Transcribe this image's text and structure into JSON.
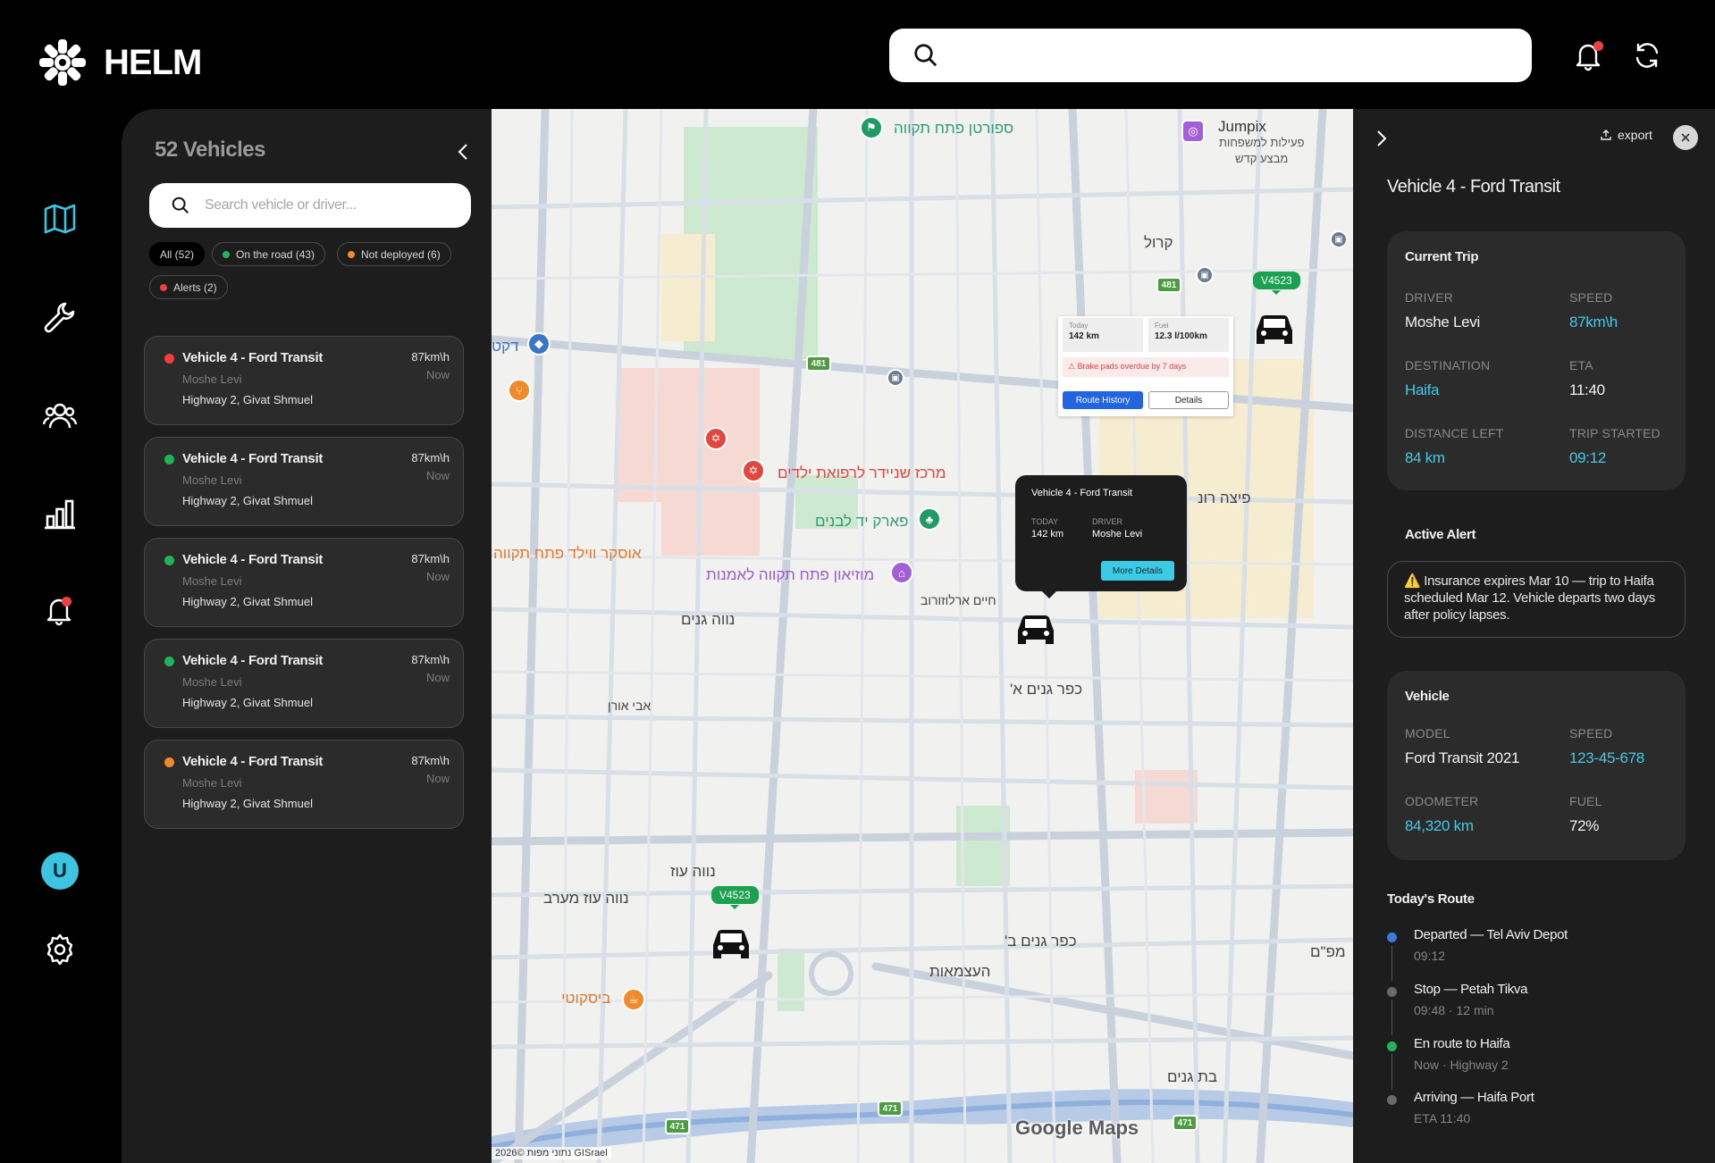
{
  "app": {
    "name": "HELM"
  },
  "topbar": {
    "search_value": ""
  },
  "vehicles_panel": {
    "title": "52 Vehicles",
    "search_placeholder": "Search vehicle or driver...",
    "filters": [
      {
        "label": "All (52)",
        "color": ""
      },
      {
        "label": "On the road (43)",
        "color": "#22b35a"
      },
      {
        "label": "Not deployed (6)",
        "color": "#f08a2b"
      },
      {
        "label": "Alerts (2)",
        "color": "#ef3f3f"
      }
    ],
    "vehicles": [
      {
        "name": "Vehicle 4 - Ford Transit",
        "driver": "Moshe Levi",
        "location": "Highway 2, Givat Shmuel",
        "speed": "87km\\h",
        "time": "Now",
        "status_color": "#ef3f3f"
      },
      {
        "name": "Vehicle 4 - Ford Transit",
        "driver": "Moshe Levi",
        "location": "Highway 2, Givat Shmuel",
        "speed": "87km\\h",
        "time": "Now",
        "status_color": "#22b35a"
      },
      {
        "name": "Vehicle 4 - Ford Transit",
        "driver": "Moshe Levi",
        "location": "Highway 2, Givat Shmuel",
        "speed": "87km\\h",
        "time": "Now",
        "status_color": "#22b35a"
      },
      {
        "name": "Vehicle 4 - Ford Transit",
        "driver": "Moshe Levi",
        "location": "Highway 2, Givat Shmuel",
        "speed": "87km\\h",
        "time": "Now",
        "status_color": "#22b35a"
      },
      {
        "name": "Vehicle 4 - Ford Transit",
        "driver": "Moshe Levi",
        "location": "Highway 2, Givat Shmuel",
        "speed": "87km\\h",
        "time": "Now",
        "status_color": "#f08a2b"
      }
    ]
  },
  "user": {
    "initial": "U"
  },
  "map": {
    "labels": [
      {
        "text": "ספורטן פתח תקווה",
        "color": "#2f9b77"
      },
      {
        "text": "Jumpix",
        "color": "#333333"
      },
      {
        "text": "פעילות למשפחות",
        "color": "#555555"
      },
      {
        "text": "מבצע קדש",
        "color": "#555555"
      },
      {
        "text": "קרול",
        "color": "#444444"
      },
      {
        "text": "מרכז שניידר לרפואת ילדים",
        "color": "#e0483f"
      },
      {
        "text": "פארק יד לבנים",
        "color": "#2f9b77"
      },
      {
        "text": "אוסקר ווילד פתח תקווה",
        "color": "#e07a2f"
      },
      {
        "text": "מוזיאון פתח תקווה לאמנות",
        "color": "#9a5ad0"
      },
      {
        "text": "נווה גנים",
        "color": "#444444"
      },
      {
        "text": "כפר גנים א'",
        "color": "#444444"
      },
      {
        "text": "נווה עוז",
        "color": "#444444"
      },
      {
        "text": "נווה עוז מערב",
        "color": "#444444"
      },
      {
        "text": "כפר גנים ב'",
        "color": "#444444"
      },
      {
        "text": "העצמאות",
        "color": "#444444"
      },
      {
        "text": "ביסקוטי",
        "color": "#e07a2f"
      },
      {
        "text": "בת גנים",
        "color": "#444444"
      },
      {
        "text": "פיצה רונ",
        "color": "#444444"
      },
      {
        "text": "חיים ארלוזורוב",
        "color": "#444444"
      },
      {
        "text": "אבי אורן",
        "color": "#444444"
      },
      {
        "text": "דקט",
        "color": "#3a76c8"
      },
      {
        "text": "מפ\"ם",
        "color": "#444444"
      }
    ],
    "road_badge": "481",
    "road_badge_2": "471",
    "vehicle_tag": "V4523",
    "info_popup": {
      "today_label": "Today",
      "today_value": "142 km",
      "fuel_label": "Fuel",
      "fuel_value": "12.3 l/100km",
      "alert": "⚠ Brake pads overdue by 7 days",
      "route_history_label": "Route History",
      "details_label": "Details"
    },
    "tooltip": {
      "title": "Vehicle 4 - Ford Transit",
      "today_label": "TODAY",
      "today_value": "142 km",
      "driver_label": "DRIVER",
      "driver_value": "Moshe Levi",
      "more_label": "More Details"
    },
    "google_logo": "Google Maps",
    "attribution": "נתוני מפות ©2026 GISrael"
  },
  "detail_panel": {
    "export_label": "export",
    "title": "Vehicle 4 - Ford Transit",
    "current_trip": {
      "heading": "Current Trip",
      "driver_label": "DRIVER",
      "driver": "Moshe Levi",
      "speed_label": "SPEED",
      "speed": "87km\\h",
      "destination_label": "DESTINATION",
      "destination": "Haifa",
      "eta_label": "ETA",
      "eta": "11:40",
      "distance_label": "DISTANCE LEFT",
      "distance": "84 km",
      "started_label": "TRIP STARTED",
      "started": "09:12"
    },
    "active_alert": {
      "heading": "Active Alert",
      "text": "⚠️ Insurance expires Mar 10 — trip to Haifa scheduled Mar 12. Vehicle departs two days after policy lapses."
    },
    "vehicle": {
      "heading": "Vehicle",
      "model_label": "MODEL",
      "model": "Ford Transit 2021",
      "speed_label": "SPEED",
      "speed": "123-45-678",
      "odometer_label": "ODOMETER",
      "odometer": "84,320 km",
      "fuel_label": "FUEL",
      "fuel": "72%"
    },
    "route": {
      "heading": "Today's Route",
      "stops": [
        {
          "title": "Departed — Tel Aviv Depot",
          "sub": "09:12",
          "color": "#3b7be0"
        },
        {
          "title": "Stop — Petah Tikva",
          "sub": "09:48 · 12 min",
          "color": "#6a6a6a"
        },
        {
          "title": "En route to Haifa",
          "sub": "Now · Highway 2",
          "color": "#22b35a"
        },
        {
          "title": "Arriving — Haifa Port",
          "sub": "ETA 11:40",
          "color": "#6a6a6a"
        }
      ]
    }
  }
}
